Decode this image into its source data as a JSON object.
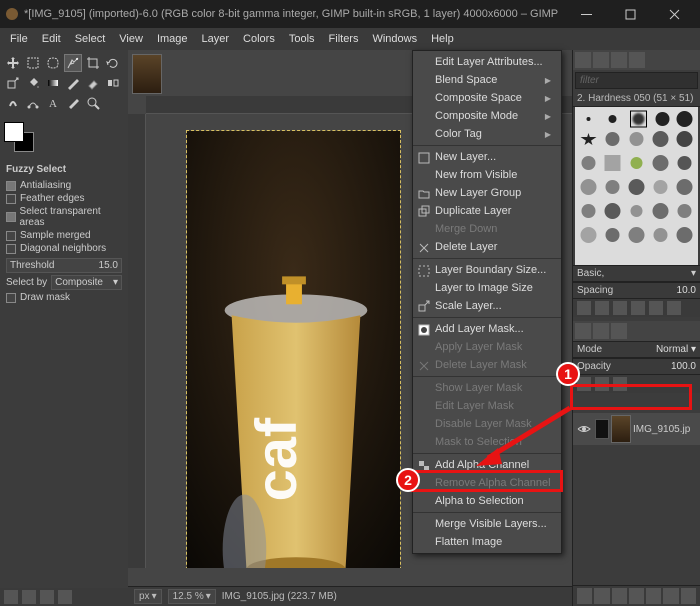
{
  "window": {
    "title": "*[IMG_9105] (imported)-6.0 (RGB color 8-bit gamma integer, GIMP built-in sRGB, 1 layer) 4000x6000 – GIMP"
  },
  "menubar": [
    "File",
    "Edit",
    "Select",
    "View",
    "Image",
    "Layer",
    "Colors",
    "Tools",
    "Filters",
    "Windows",
    "Help"
  ],
  "tooloptions": {
    "title": "Fuzzy Select",
    "antialiasing": "Antialiasing",
    "feather": "Feather edges",
    "transparent": "Select transparent areas",
    "sample_merged": "Sample merged",
    "diag": "Diagonal neighbors",
    "threshold_label": "Threshold",
    "threshold_value": "15.0",
    "selectby_label": "Select by",
    "selectby_value": "Composite",
    "drawmask": "Draw mask"
  },
  "statusbar": {
    "unit": "px",
    "zoom": "12.5 %",
    "file": "IMG_9105.jpg (223.7 MB)"
  },
  "right": {
    "filter_placeholder": "filter",
    "brush_name": "2. Hardness 050 (51 × 51)",
    "basic": "Basic,",
    "spacing_label": "Spacing",
    "spacing_value": "10.0",
    "mode_label": "Mode",
    "mode_value": "Normal",
    "opacity_label": "Opacity",
    "opacity_value": "100.0",
    "layer_name": "IMG_9105.jp"
  },
  "context_menu": {
    "edit_attrs": "Edit Layer Attributes...",
    "blend_space": "Blend Space",
    "composite_space": "Composite Space",
    "composite_mode": "Composite Mode",
    "color_tag": "Color Tag",
    "new_layer": "New Layer...",
    "new_from_visible": "New from Visible",
    "new_layer_group": "New Layer Group",
    "duplicate_layer": "Duplicate Layer",
    "merge_down": "Merge Down",
    "delete_layer": "Delete Layer",
    "layer_boundary": "Layer Boundary Size...",
    "layer_to_image": "Layer to Image Size",
    "scale_layer": "Scale Layer...",
    "add_layer_mask": "Add Layer Mask...",
    "apply_layer_mask": "Apply Layer Mask",
    "delete_layer_mask": "Delete Layer Mask",
    "show_layer_mask": "Show Layer Mask",
    "edit_layer_mask": "Edit Layer Mask",
    "disable_layer_mask": "Disable Layer Mask",
    "mask_to_selection": "Mask to Selection",
    "add_alpha": "Add Alpha Channel",
    "remove_alpha": "Remove Alpha Channel",
    "alpha_to_selection": "Alpha to Selection",
    "merge_visible": "Merge Visible Layers...",
    "flatten": "Flatten Image"
  },
  "annotations": {
    "step1": "1",
    "step2": "2"
  }
}
